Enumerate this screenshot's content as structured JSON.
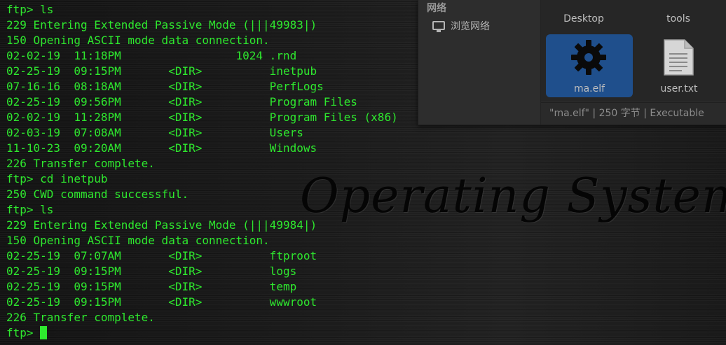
{
  "terminal": {
    "lines": [
      "ftp> ls",
      "229 Entering Extended Passive Mode (|||49983|)",
      "150 Opening ASCII mode data connection.",
      "02-02-19  11:18PM                 1024 .rnd",
      "02-25-19  09:15PM       <DIR>          inetpub",
      "07-16-16  08:18AM       <DIR>          PerfLogs",
      "02-25-19  09:56PM       <DIR>          Program Files",
      "02-02-19  11:28PM       <DIR>          Program Files (x86)",
      "02-03-19  07:08AM       <DIR>          Users",
      "11-10-23  09:20AM       <DIR>          Windows",
      "226 Transfer complete.",
      "ftp> cd inetpub",
      "250 CWD command successful.",
      "ftp> ls",
      "229 Entering Extended Passive Mode (|||49984|)",
      "150 Opening ASCII mode data connection.",
      "02-25-19  07:07AM       <DIR>          ftproot",
      "02-25-19  09:15PM       <DIR>          logs",
      "02-25-19  09:15PM       <DIR>          temp",
      "02-25-19  09:15PM       <DIR>          wwwroot",
      "226 Transfer complete."
    ],
    "prompt": "ftp> ",
    "text_color": "#2ee82e"
  },
  "file_manager": {
    "sidebar_section": "网络",
    "sidebar_item": "浏览网络",
    "sidebar_item_icon": "monitor-icon",
    "files": {
      "desktop_label": "Desktop",
      "tools_label": "tools",
      "elf_label": "ma.elf",
      "elf_icon": "gear-icon",
      "txt_label": "user.txt",
      "txt_icon": "text-file-icon"
    },
    "status": "\"ma.elf\" | 250 字节 | Executable",
    "selection_color": "#1f4f8c"
  },
  "wallpaper": {
    "text": "Operating System Ha"
  }
}
